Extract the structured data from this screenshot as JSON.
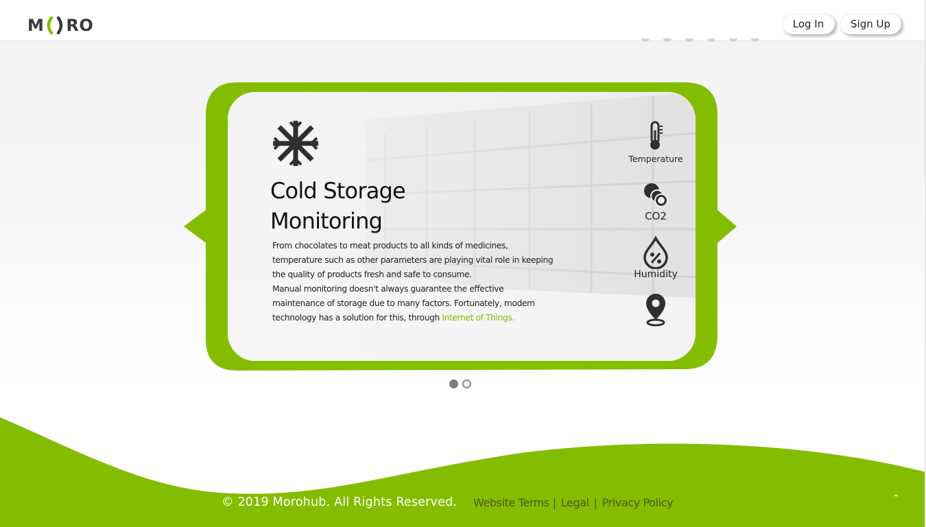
{
  "header": {
    "logo": {
      "left": "M",
      "right": "RO",
      "accent_color": "#84bd00"
    },
    "login_label": "Log In",
    "signup_label": "Sign Up"
  },
  "slide": {
    "title_line1": "Cold Storage",
    "title_line2": "Monitoring",
    "paragraph1": "From chocolates to meat products to all kinds of medicines, temperature such as other parameters are playing vital role in keeping the quality of products fresh and safe to consume.",
    "paragraph2_prefix": "Manual monitoring doesn't always guarantee the effective maintenance of storage due to many factors. Fortunately, modern technology has a solution for this, through ",
    "paragraph2_link": "Internet of Things.",
    "main_icon": "snowflake-icon",
    "metrics": [
      {
        "icon": "thermometer-icon",
        "label": "Temperature"
      },
      {
        "icon": "co2-icon",
        "label": "CO2"
      },
      {
        "icon": "humidity-icon",
        "label": "Humidity"
      },
      {
        "icon": "location-pin-icon",
        "label": ""
      }
    ]
  },
  "pager": {
    "total": 2,
    "active": 1
  },
  "footer": {
    "copyright": "© 2019 Morohub. All Rights Reserved.",
    "links": [
      "Website Terms",
      "Legal",
      "Privacy Policy"
    ],
    "back_to_top": "⌃"
  },
  "colors": {
    "brand_green": "#84bd00",
    "text_dark": "#222222",
    "footer_link": "#4a5a1e"
  }
}
